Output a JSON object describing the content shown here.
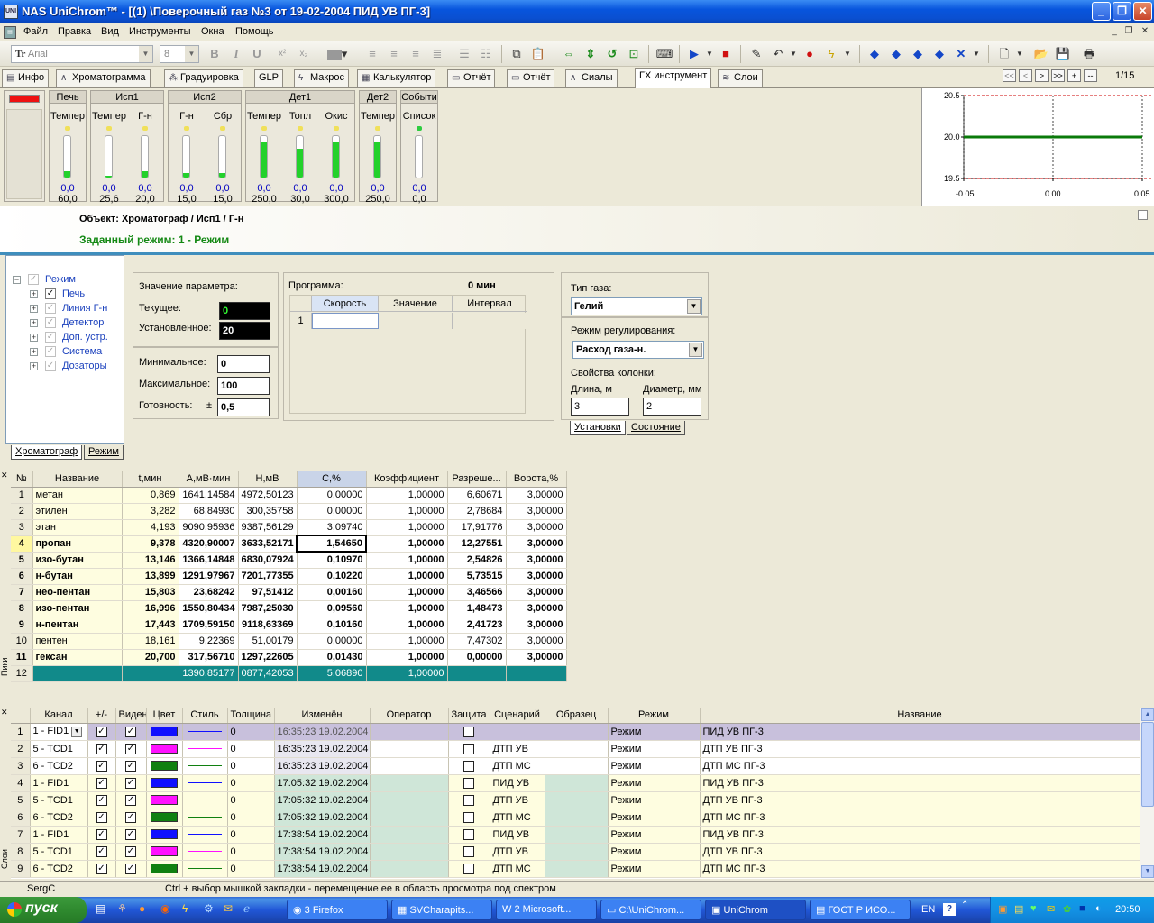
{
  "window": {
    "title": "NAS UniChrom™ - [(1) \\Поверочный газ  №3  от 19-02-2004 ПИД УВ ПГ-3]",
    "app_icon": "UNI"
  },
  "menu": [
    "Файл",
    "Правка",
    "Вид",
    "Инструменты",
    "Окна",
    "Помощь"
  ],
  "toolbar": {
    "font_name": "Arial",
    "font_size": "8",
    "bold": "B",
    "italic": "I",
    "underline": "U",
    "superscript": "x²",
    "subscript": "x₂"
  },
  "tabs": [
    {
      "label": "Инфо"
    },
    {
      "label": "Хроматограмма"
    },
    {
      "label": "Градуировка"
    },
    {
      "label": "GLP"
    },
    {
      "label": "Макрос"
    },
    {
      "label": "Калькулятор"
    },
    {
      "label": "Отчёт"
    },
    {
      "label": "Отчёт"
    },
    {
      "label": "Сиалы"
    },
    {
      "label": "ГХ инструмент"
    },
    {
      "label": "Слои"
    }
  ],
  "tab_nav": {
    "first": "<<",
    "prev": "<",
    "next": ">",
    "last": ">>",
    "add": "+",
    "remove": "--",
    "page": "1/15"
  },
  "instrument": {
    "groups": [
      {
        "name": "Печь",
        "cols": [
          {
            "label": "Темпер",
            "v1": "0,0",
            "v2": "60,0",
            "level": 0.15,
            "led": "yellow"
          }
        ]
      },
      {
        "name": "Исп1",
        "cols": [
          {
            "label": "Темпер",
            "v1": "0,0",
            "v2": "25,6",
            "level": 0.05,
            "led": "yellow"
          },
          {
            "label": "Г-н",
            "v1": "0,0",
            "v2": "20,0",
            "level": 0.15,
            "led": "yellow"
          }
        ]
      },
      {
        "name": "Исп2",
        "cols": [
          {
            "label": "Г-н",
            "v1": "0,0",
            "v2": "15,0",
            "level": 0.1,
            "led": "yellow"
          },
          {
            "label": "Сбр",
            "v1": "0,0",
            "v2": "15,0",
            "level": 0.1,
            "led": "yellow"
          }
        ]
      },
      {
        "name": "Дет1",
        "cols": [
          {
            "label": "Темпер",
            "v1": "0,0",
            "v2": "250,0",
            "level": 0.85,
            "led": "yellow"
          },
          {
            "label": "Топл",
            "v1": "0,0",
            "v2": "30,0",
            "level": 0.7,
            "led": "yellow"
          },
          {
            "label": "Окис",
            "v1": "0,0",
            "v2": "300,0",
            "level": 0.85,
            "led": "yellow"
          }
        ]
      },
      {
        "name": "Дет2",
        "cols": [
          {
            "label": "Темпер",
            "v1": "0,0",
            "v2": "250,0",
            "level": 0.85,
            "led": "yellow"
          }
        ]
      },
      {
        "name": "Событи",
        "cols": [
          {
            "label": "Список",
            "v1": "0,0",
            "v2": "0,0",
            "level": 0.0,
            "led": "green"
          }
        ]
      }
    ]
  },
  "chart_data": {
    "type": "line",
    "title": "",
    "xlabel": "",
    "ylabel": "",
    "x_ticks": [
      "-0.05",
      "0.00",
      "0.05"
    ],
    "y_ticks": [
      "20.5",
      "20.0",
      "19.5"
    ],
    "xlim": [
      -0.05,
      0.05
    ],
    "ylim": [
      19.5,
      20.5
    ],
    "series": [
      {
        "x": [
          -0.05,
          0.05
        ],
        "y": [
          20.0,
          20.0
        ],
        "color": "#0a7a0a"
      }
    ],
    "limits": [
      {
        "y": 20.5,
        "color": "#cc0000",
        "style": "dashed"
      },
      {
        "y": 19.5,
        "color": "#cc0000",
        "style": "dashed"
      }
    ],
    "vlines": [
      {
        "x": -0.05,
        "style": "dashed"
      },
      {
        "x": 0.0,
        "style": "dashed"
      },
      {
        "x": 0.05,
        "style": "dashed"
      }
    ],
    "grid": false
  },
  "info": {
    "object": "Объект: Хроматограф / Исп1 / Г-н",
    "mode": "Заданный режим: 1 - Режим"
  },
  "tree": {
    "root": "Режим",
    "items": [
      "Печь",
      "Линия Г-н",
      "Детектор",
      "Доп. устр.",
      "Система",
      "Дозаторы"
    ],
    "tabs": [
      "Хроматограф",
      "Режим"
    ]
  },
  "param": {
    "title": "Значение параметра:",
    "current_label": "Текущее:",
    "current": "0",
    "set_label": "Установленное:",
    "set": "20",
    "min_label": "Минимальное:",
    "min": "0",
    "max_label": "Максимальное:",
    "max": "100",
    "ready_label": "Готовность:",
    "ready_sign": "±",
    "ready": "0,5"
  },
  "program": {
    "title": "Программа:",
    "time": "0 мин",
    "cols": [
      "Скорость",
      "Значение",
      "Интервал"
    ],
    "row_no": "1"
  },
  "gas": {
    "type_label": "Тип газа:",
    "type": "Гелий",
    "reg_label": "Режим регулирования:",
    "reg": "Расход газа-н.",
    "col_label": "Свойства колонки:",
    "len_label": "Длина, м",
    "len": "3",
    "dia_label": "Диаметр, мм",
    "dia": "2",
    "tabs": [
      "Установки",
      "Состояние"
    ]
  },
  "peaks": {
    "side_label": "Пики",
    "headers": [
      "№",
      "Название",
      "t,мин",
      "А,мВ·мин",
      "Н,мВ",
      "С,%",
      "Коэффициент",
      "Разреше...",
      "Ворота,%"
    ],
    "rows": [
      [
        "1",
        "метан",
        "0,869",
        "1641,14584",
        "4972,50123",
        "0,00000",
        "1,00000",
        "6,60671",
        "3,00000"
      ],
      [
        "2",
        "этилен",
        "3,282",
        "68,84930",
        "300,35758",
        "0,00000",
        "1,00000",
        "2,78684",
        "3,00000"
      ],
      [
        "3",
        "этан",
        "4,193",
        "9090,95936",
        "9387,56129",
        "3,09740",
        "1,00000",
        "17,91776",
        "3,00000"
      ],
      [
        "4",
        "пропан",
        "9,378",
        "4320,90007",
        "3633,52171",
        "1,54650",
        "1,00000",
        "12,27551",
        "3,00000"
      ],
      [
        "5",
        "изо-бутан",
        "13,146",
        "1366,14848",
        "6830,07924",
        "0,10970",
        "1,00000",
        "2,54826",
        "3,00000"
      ],
      [
        "6",
        "н-бутан",
        "13,899",
        "1291,97967",
        "7201,77355",
        "0,10220",
        "1,00000",
        "5,73515",
        "3,00000"
      ],
      [
        "7",
        "нео-пентан",
        "15,803",
        "23,68242",
        "97,51412",
        "0,00160",
        "1,00000",
        "3,46566",
        "3,00000"
      ],
      [
        "8",
        "изо-пентан",
        "16,996",
        "1550,80434",
        "7987,25030",
        "0,09560",
        "1,00000",
        "1,48473",
        "3,00000"
      ],
      [
        "9",
        "н-пентан",
        "17,443",
        "1709,59150",
        "9118,63369",
        "0,10160",
        "1,00000",
        "2,41723",
        "3,00000"
      ],
      [
        "10",
        "пентен",
        "18,161",
        "9,22369",
        "51,00179",
        "0,00000",
        "1,00000",
        "7,47302",
        "3,00000"
      ],
      [
        "11",
        "гексан",
        "20,700",
        "317,56710",
        "1297,22605",
        "0,01430",
        "1,00000",
        "0,00000",
        "3,00000"
      ]
    ],
    "bold_rows": [
      3,
      4,
      5,
      6,
      7,
      8,
      10
    ],
    "total": [
      "12",
      "",
      "",
      "1390,85177",
      "0877,42053",
      "5,06890",
      "1,00000",
      "",
      ""
    ]
  },
  "layers": {
    "side_label": "Слои",
    "headers": [
      "",
      "Канал",
      "+/-",
      "Виден",
      "Цвет",
      "Стиль",
      "Толщина",
      "Изменён",
      "Оператор",
      "Защита",
      "Сценарий",
      "Образец",
      "Режим",
      "Название"
    ],
    "rows": [
      {
        "n": "1",
        "ch": "1 - FID1",
        "color": "#1010ff",
        "w": "0",
        "changed": "16:35:23 19.02.2004",
        "scen": "",
        "mode": "Режим",
        "name": "ПИД УВ ПГ-3"
      },
      {
        "n": "2",
        "ch": "5 - TCD1",
        "color": "#ff10ff",
        "w": "0",
        "changed": "16:35:23 19.02.2004",
        "scen": "ДТП  УВ",
        "mode": "Режим",
        "name": "ДТП УВ ПГ-3"
      },
      {
        "n": "3",
        "ch": "6 - TCD2",
        "color": "#108010",
        "w": "0",
        "changed": "16:35:23 19.02.2004",
        "scen": "ДТП  МС",
        "mode": "Режим",
        "name": "ДТП МС ПГ-3"
      },
      {
        "n": "4",
        "ch": "1 - FID1",
        "color": "#1010ff",
        "w": "0",
        "changed": "17:05:32 19.02.2004",
        "scen": "ПИД  УВ",
        "mode": "Режим",
        "name": "ПИД УВ ПГ-3"
      },
      {
        "n": "5",
        "ch": "5 - TCD1",
        "color": "#ff10ff",
        "w": "0",
        "changed": "17:05:32 19.02.2004",
        "scen": "ДТП  УВ",
        "mode": "Режим",
        "name": "ДТП УВ ПГ-3"
      },
      {
        "n": "6",
        "ch": "6 - TCD2",
        "color": "#108010",
        "w": "0",
        "changed": "17:05:32 19.02.2004",
        "scen": "ДТП  МС",
        "mode": "Режим",
        "name": "ДТП МС ПГ-3"
      },
      {
        "n": "7",
        "ch": "1 - FID1",
        "color": "#1010ff",
        "w": "0",
        "changed": "17:38:54 19.02.2004",
        "scen": "ПИД  УВ",
        "mode": "Режим",
        "name": "ПИД УВ ПГ-3"
      },
      {
        "n": "8",
        "ch": "5 - TCD1",
        "color": "#ff10ff",
        "w": "0",
        "changed": "17:38:54 19.02.2004",
        "scen": "ДТП  УВ",
        "mode": "Режим",
        "name": "ДТП УВ ПГ-3"
      },
      {
        "n": "9",
        "ch": "6 - TCD2",
        "color": "#108010",
        "w": "0",
        "changed": "17:38:54 19.02.2004",
        "scen": "ДТП  МС",
        "mode": "Режим",
        "name": "ДТП МС ПГ-3"
      }
    ]
  },
  "status": {
    "user": "SergC",
    "hint": "Ctrl + выбор мышкой закладки - перемещение ее в область просмотра под спектром"
  },
  "taskbar": {
    "start": "пуск",
    "tasks": [
      "3 Firefox",
      "SVCharapits...",
      "2 Microsoft...",
      "C:\\UniChrom...",
      "UniChrom",
      "ГОСТ Р ИСО..."
    ],
    "lang": "EN",
    "clock": "20:50"
  }
}
